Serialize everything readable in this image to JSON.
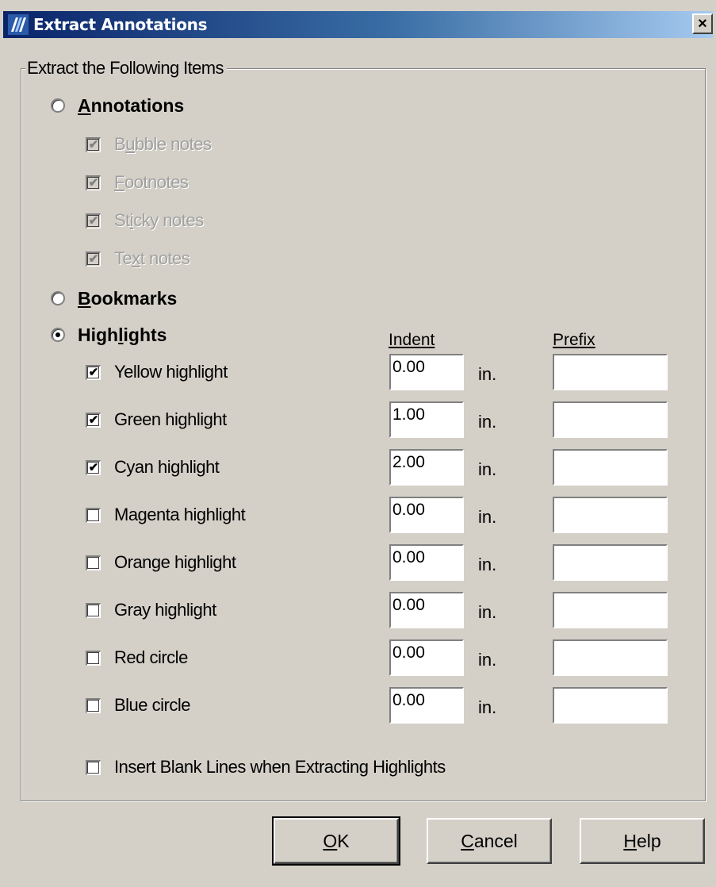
{
  "window": {
    "title": "Extract Annotations",
    "icon": "app-icon",
    "close_glyph": "×"
  },
  "group": {
    "legend": "Extract the Following Items"
  },
  "options": {
    "annotations": {
      "label": "Annotations",
      "selected": false,
      "items": [
        {
          "label": "Bubble notes",
          "checked": true,
          "enabled": false
        },
        {
          "label": "Footnotes",
          "checked": true,
          "enabled": false
        },
        {
          "label": "Sticky notes",
          "checked": true,
          "enabled": false
        },
        {
          "label": "Text notes",
          "checked": true,
          "enabled": false
        }
      ]
    },
    "bookmarks": {
      "label": "Bookmarks",
      "selected": false
    },
    "highlights": {
      "label": "Highlights",
      "selected": true,
      "indent_header": "Indent",
      "prefix_header": "Prefix",
      "unit": "in.",
      "rows": [
        {
          "label": "Yellow highlight",
          "checked": true,
          "indent": "0.00",
          "prefix": ""
        },
        {
          "label": "Green highlight",
          "checked": true,
          "indent": "1.00",
          "prefix": ""
        },
        {
          "label": "Cyan highlight",
          "checked": true,
          "indent": "2.00",
          "prefix": ""
        },
        {
          "label": "Magenta highlight",
          "checked": false,
          "indent": "0.00",
          "prefix": ""
        },
        {
          "label": "Orange highlight",
          "checked": false,
          "indent": "0.00",
          "prefix": ""
        },
        {
          "label": "Gray highlight",
          "checked": false,
          "indent": "0.00",
          "prefix": ""
        },
        {
          "label": "Red circle",
          "checked": false,
          "indent": "0.00",
          "prefix": ""
        },
        {
          "label": "Blue circle",
          "checked": false,
          "indent": "0.00",
          "prefix": ""
        }
      ]
    },
    "insert_blank": {
      "label": "Insert Blank Lines when Extracting Highlights",
      "checked": false
    }
  },
  "buttons": {
    "ok": "OK",
    "cancel": "Cancel",
    "help": "Help"
  },
  "colors": {
    "face": "#d4d0c8",
    "title_start": "#0a246a",
    "title_end": "#a6caf0"
  }
}
